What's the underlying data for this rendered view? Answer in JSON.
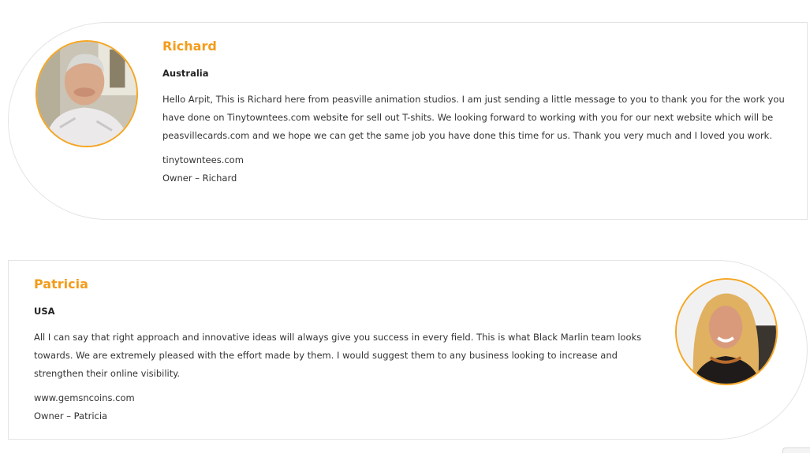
{
  "testimonials": [
    {
      "name": "Richard",
      "country": "Australia",
      "message": "Hello Arpit, This is Richard here from peasville animation studios. I am just sending a little message to you to thank you for the work you have done on Tinytowntees.com website for sell out T-shits. We looking forward to working with you for our next website which will be peasvillecards.com and we hope we can get the same job you have done this time for us. Thank you very much and I loved you work.",
      "website": "tinytowntees.com",
      "role": "Owner – Richard",
      "accent": "#f39c1b"
    },
    {
      "name": "Patricia",
      "country": "USA",
      "message": "All I can say that right approach and innovative ideas will always give you success in every field. This is what Black Marlin team looks towards. We are extremely pleased with the effort made by them. I would suggest them to any business looking to increase and strengthen their online visibility.",
      "website": "www.gemsncoins.com",
      "role": "Owner – Patricia",
      "accent": "#f39c1b"
    }
  ]
}
